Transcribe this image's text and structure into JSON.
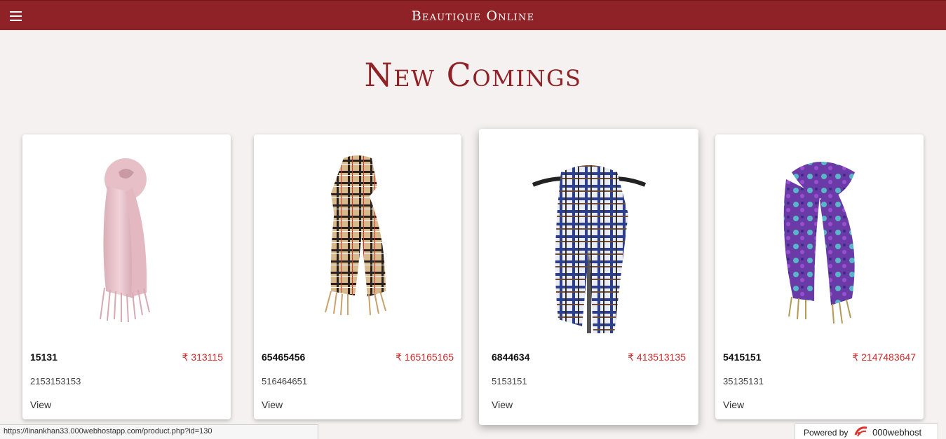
{
  "header": {
    "brand": "Beautique Online",
    "menu_icon": "hamburger-menu-icon",
    "color": "#8f2226"
  },
  "main": {
    "title": "New Comings",
    "products": [
      {
        "name": "15131",
        "price": "₹ 313115",
        "subtitle": "2153153153",
        "link": "View",
        "image_icon": "pink-scarf-image"
      },
      {
        "name": "65465456",
        "price": "₹ 165165165",
        "subtitle": "516464651",
        "link": "View",
        "image_icon": "beige-plaid-scarf-image"
      },
      {
        "name": "6844634",
        "price": "₹ 413513135",
        "subtitle": "5153151",
        "link": "View",
        "image_icon": "blue-plaid-scarf-image"
      },
      {
        "name": "5415151",
        "price": "₹ 2147483647",
        "subtitle": "35135131",
        "link": "View",
        "image_icon": "purple-paisley-scarf-image"
      }
    ]
  },
  "status_bar": {
    "url": "https://linankhan33.000webhostapp.com/product.php?id=130"
  },
  "powered_badge": {
    "label": "Powered by",
    "host": "000webhost"
  },
  "colors": {
    "accent": "#8f2226",
    "price": "#d22a2a",
    "background": "#f5f1f0"
  }
}
